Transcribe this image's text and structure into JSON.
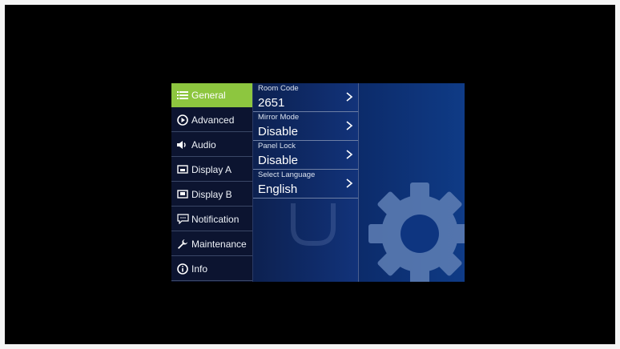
{
  "sidebar": {
    "items": [
      {
        "label": "General",
        "icon": "list-icon",
        "active": true
      },
      {
        "label": "Advanced",
        "icon": "play-circle-icon",
        "active": false
      },
      {
        "label": "Audio",
        "icon": "speaker-icon",
        "active": false
      },
      {
        "label": "Display A",
        "icon": "display-icon",
        "active": false
      },
      {
        "label": "Display B",
        "icon": "display-icon",
        "active": false
      },
      {
        "label": "Notification",
        "icon": "chat-icon",
        "active": false
      },
      {
        "label": "Maintenance",
        "icon": "wrench-icon",
        "active": false
      },
      {
        "label": "Info",
        "icon": "info-icon",
        "active": false
      }
    ]
  },
  "settings": {
    "rows": [
      {
        "label": "Room Code",
        "value": "2651"
      },
      {
        "label": "Mirror Mode",
        "value": "Disable"
      },
      {
        "label": "Panel Lock",
        "value": "Disable"
      },
      {
        "label": "Select Language",
        "value": "English"
      }
    ]
  },
  "colors": {
    "accent": "#8dc63f",
    "panel_bg": "#0a1a3d",
    "screen_bg": "#000000"
  }
}
